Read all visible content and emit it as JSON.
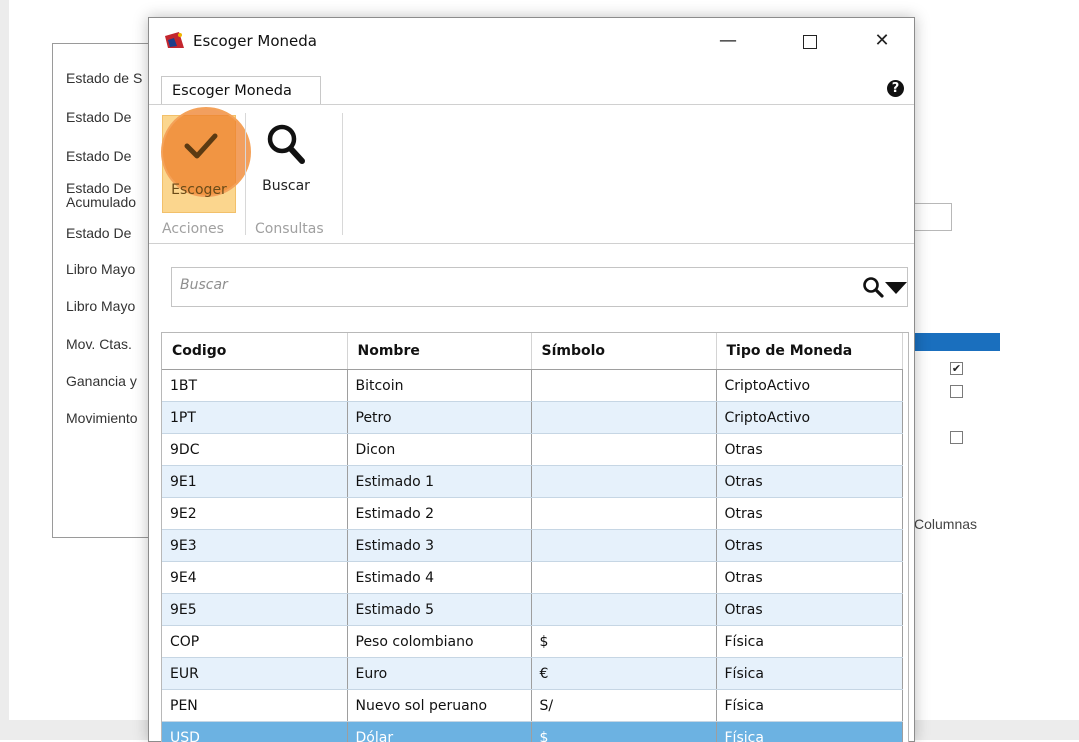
{
  "background_app": {
    "report_items": [
      "Estado de S",
      "Estado De",
      "Estado De",
      "Estado De\nAcumulado",
      "Estado De",
      "Libro Mayo",
      "Libro Mayo",
      "Mov. Ctas.",
      "Ganancia y",
      "Movimiento"
    ],
    "columnas_label": "Columnas"
  },
  "dialog": {
    "title": "Escoger Moneda",
    "window_buttons": {
      "minimize": "—",
      "close": "✕"
    },
    "ribbon_tab": "Escoger Moneda",
    "help": "?",
    "ribbon": {
      "escoger_label": "Escoger",
      "buscar_label": "Buscar",
      "group_acciones": "Acciones",
      "group_consultas": "Consultas"
    },
    "search": {
      "placeholder": "Buscar"
    },
    "table": {
      "columns": [
        "Codigo",
        "Nombre",
        "Símbolo",
        "Tipo de Moneda"
      ],
      "rows": [
        [
          "1BT",
          "Bitcoin",
          "",
          "CriptoActivo"
        ],
        [
          "1PT",
          "Petro",
          "",
          "CriptoActivo"
        ],
        [
          "9DC",
          "Dicon",
          "",
          "Otras"
        ],
        [
          "9E1",
          "Estimado 1",
          "",
          "Otras"
        ],
        [
          "9E2",
          "Estimado 2",
          "",
          "Otras"
        ],
        [
          "9E3",
          "Estimado 3",
          "",
          "Otras"
        ],
        [
          "9E4",
          "Estimado 4",
          "",
          "Otras"
        ],
        [
          "9E5",
          "Estimado 5",
          "",
          "Otras"
        ],
        [
          "COP",
          "Peso colombiano",
          "$",
          "Física"
        ],
        [
          "EUR",
          "Euro",
          "€",
          "Física"
        ],
        [
          "PEN",
          "Nuevo sol peruano",
          "S/",
          "Física"
        ],
        [
          "USD",
          "Dólar",
          "$",
          "Física"
        ]
      ],
      "selected_code": "USD"
    }
  },
  "colors": {
    "accent_blue": "#1a6fbe",
    "selection": "#6cb2e2",
    "alt_row": "#e6f1fb",
    "highlight": "#ed7f2a"
  }
}
